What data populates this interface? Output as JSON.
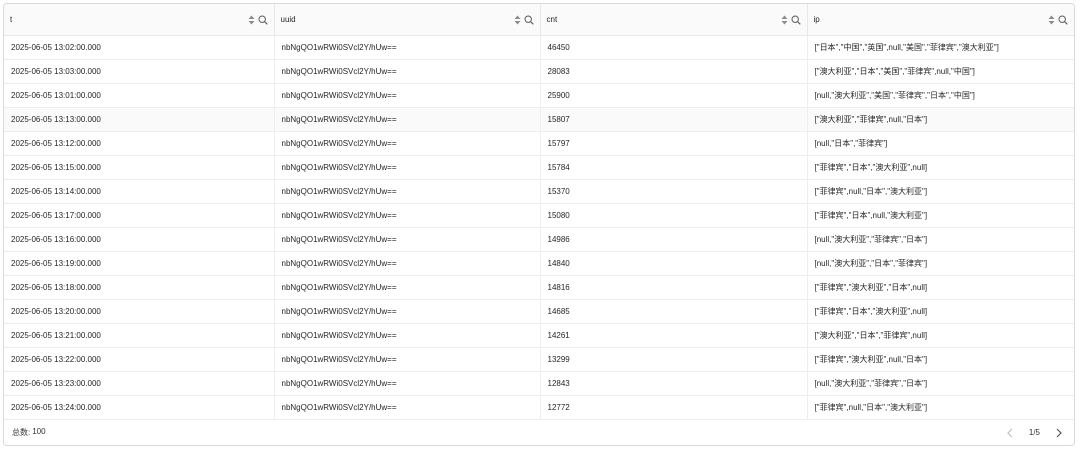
{
  "table": {
    "columns": [
      {
        "key": "t",
        "label": "t"
      },
      {
        "key": "uuid",
        "label": "uuid"
      },
      {
        "key": "cnt",
        "label": "cnt"
      },
      {
        "key": "ip",
        "label": "ip"
      }
    ],
    "rows": [
      [
        "2025-06-05 13:02:00.000",
        "nbNgQO1wRWi0SVcl2Y/hUw==",
        "46450",
        "[\"日本\",\"中国\",\"英国\",null,\"美国\",\"菲律宾\",\"澳大利亚\"]"
      ],
      [
        "2025-06-05 13:03:00.000",
        "nbNgQO1wRWi0SVcl2Y/hUw==",
        "28083",
        "[\"澳大利亚\",\"日本\",\"美国\",\"菲律宾\",null,\"中国\"]"
      ],
      [
        "2025-06-05 13:01:00.000",
        "nbNgQO1wRWi0SVcl2Y/hUw==",
        "25900",
        "[null,\"澳大利亚\",\"美国\",\"菲律宾\",\"日本\",\"中国\"]"
      ],
      [
        "2025-06-05 13:13:00.000",
        "nbNgQO1wRWi0SVcl2Y/hUw==",
        "15807",
        "[\"澳大利亚\",\"菲律宾\",null,\"日本\"]"
      ],
      [
        "2025-06-05 13:12:00.000",
        "nbNgQO1wRWi0SVcl2Y/hUw==",
        "15797",
        "[null,\"日本\",\"菲律宾\"]"
      ],
      [
        "2025-06-05 13:15:00.000",
        "nbNgQO1wRWi0SVcl2Y/hUw==",
        "15784",
        "[\"菲律宾\",\"日本\",\"澳大利亚\",null]"
      ],
      [
        "2025-06-05 13:14:00.000",
        "nbNgQO1wRWi0SVcl2Y/hUw==",
        "15370",
        "[\"菲律宾\",null,\"日本\",\"澳大利亚\"]"
      ],
      [
        "2025-06-05 13:17:00.000",
        "nbNgQO1wRWi0SVcl2Y/hUw==",
        "15080",
        "[\"菲律宾\",\"日本\",null,\"澳大利亚\"]"
      ],
      [
        "2025-06-05 13:16:00.000",
        "nbNgQO1wRWi0SVcl2Y/hUw==",
        "14986",
        "[null,\"澳大利亚\",\"菲律宾\",\"日本\"]"
      ],
      [
        "2025-06-05 13:19:00.000",
        "nbNgQO1wRWi0SVcl2Y/hUw==",
        "14840",
        "[null,\"澳大利亚\",\"日本\",\"菲律宾\"]"
      ],
      [
        "2025-06-05 13:18:00.000",
        "nbNgQO1wRWi0SVcl2Y/hUw==",
        "14816",
        "[\"菲律宾\",\"澳大利亚\",\"日本\",null]"
      ],
      [
        "2025-06-05 13:20:00.000",
        "nbNgQO1wRWi0SVcl2Y/hUw==",
        "14685",
        "[\"菲律宾\",\"日本\",\"澳大利亚\",null]"
      ],
      [
        "2025-06-05 13:21:00.000",
        "nbNgQO1wRWi0SVcl2Y/hUw==",
        "14261",
        "[\"澳大利亚\",\"日本\",\"菲律宾\",null]"
      ],
      [
        "2025-06-05 13:22:00.000",
        "nbNgQO1wRWi0SVcl2Y/hUw==",
        "13299",
        "[\"菲律宾\",\"澳大利亚\",null,\"日本\"]"
      ],
      [
        "2025-06-05 13:23:00.000",
        "nbNgQO1wRWi0SVcl2Y/hUw==",
        "12843",
        "[null,\"澳大利亚\",\"菲律宾\",\"日本\"]"
      ],
      [
        "2025-06-05 13:24:00.000",
        "nbNgQO1wRWi0SVcl2Y/hUw==",
        "12772",
        "[\"菲律宾\",null,\"日本\",\"澳大利亚\"]"
      ]
    ],
    "hover_row_index": 3
  },
  "footer": {
    "total_label": "总数:",
    "total_value": "100",
    "page_indicator": "1/5"
  },
  "icons": {
    "sort": "sort-icon",
    "search": "search-icon",
    "prev": "chevron-left-icon",
    "next": "chevron-right-icon"
  },
  "colors": {
    "border": "#d9d9d9",
    "header_bg": "#fafafa",
    "hover_bg": "#fafafa"
  }
}
